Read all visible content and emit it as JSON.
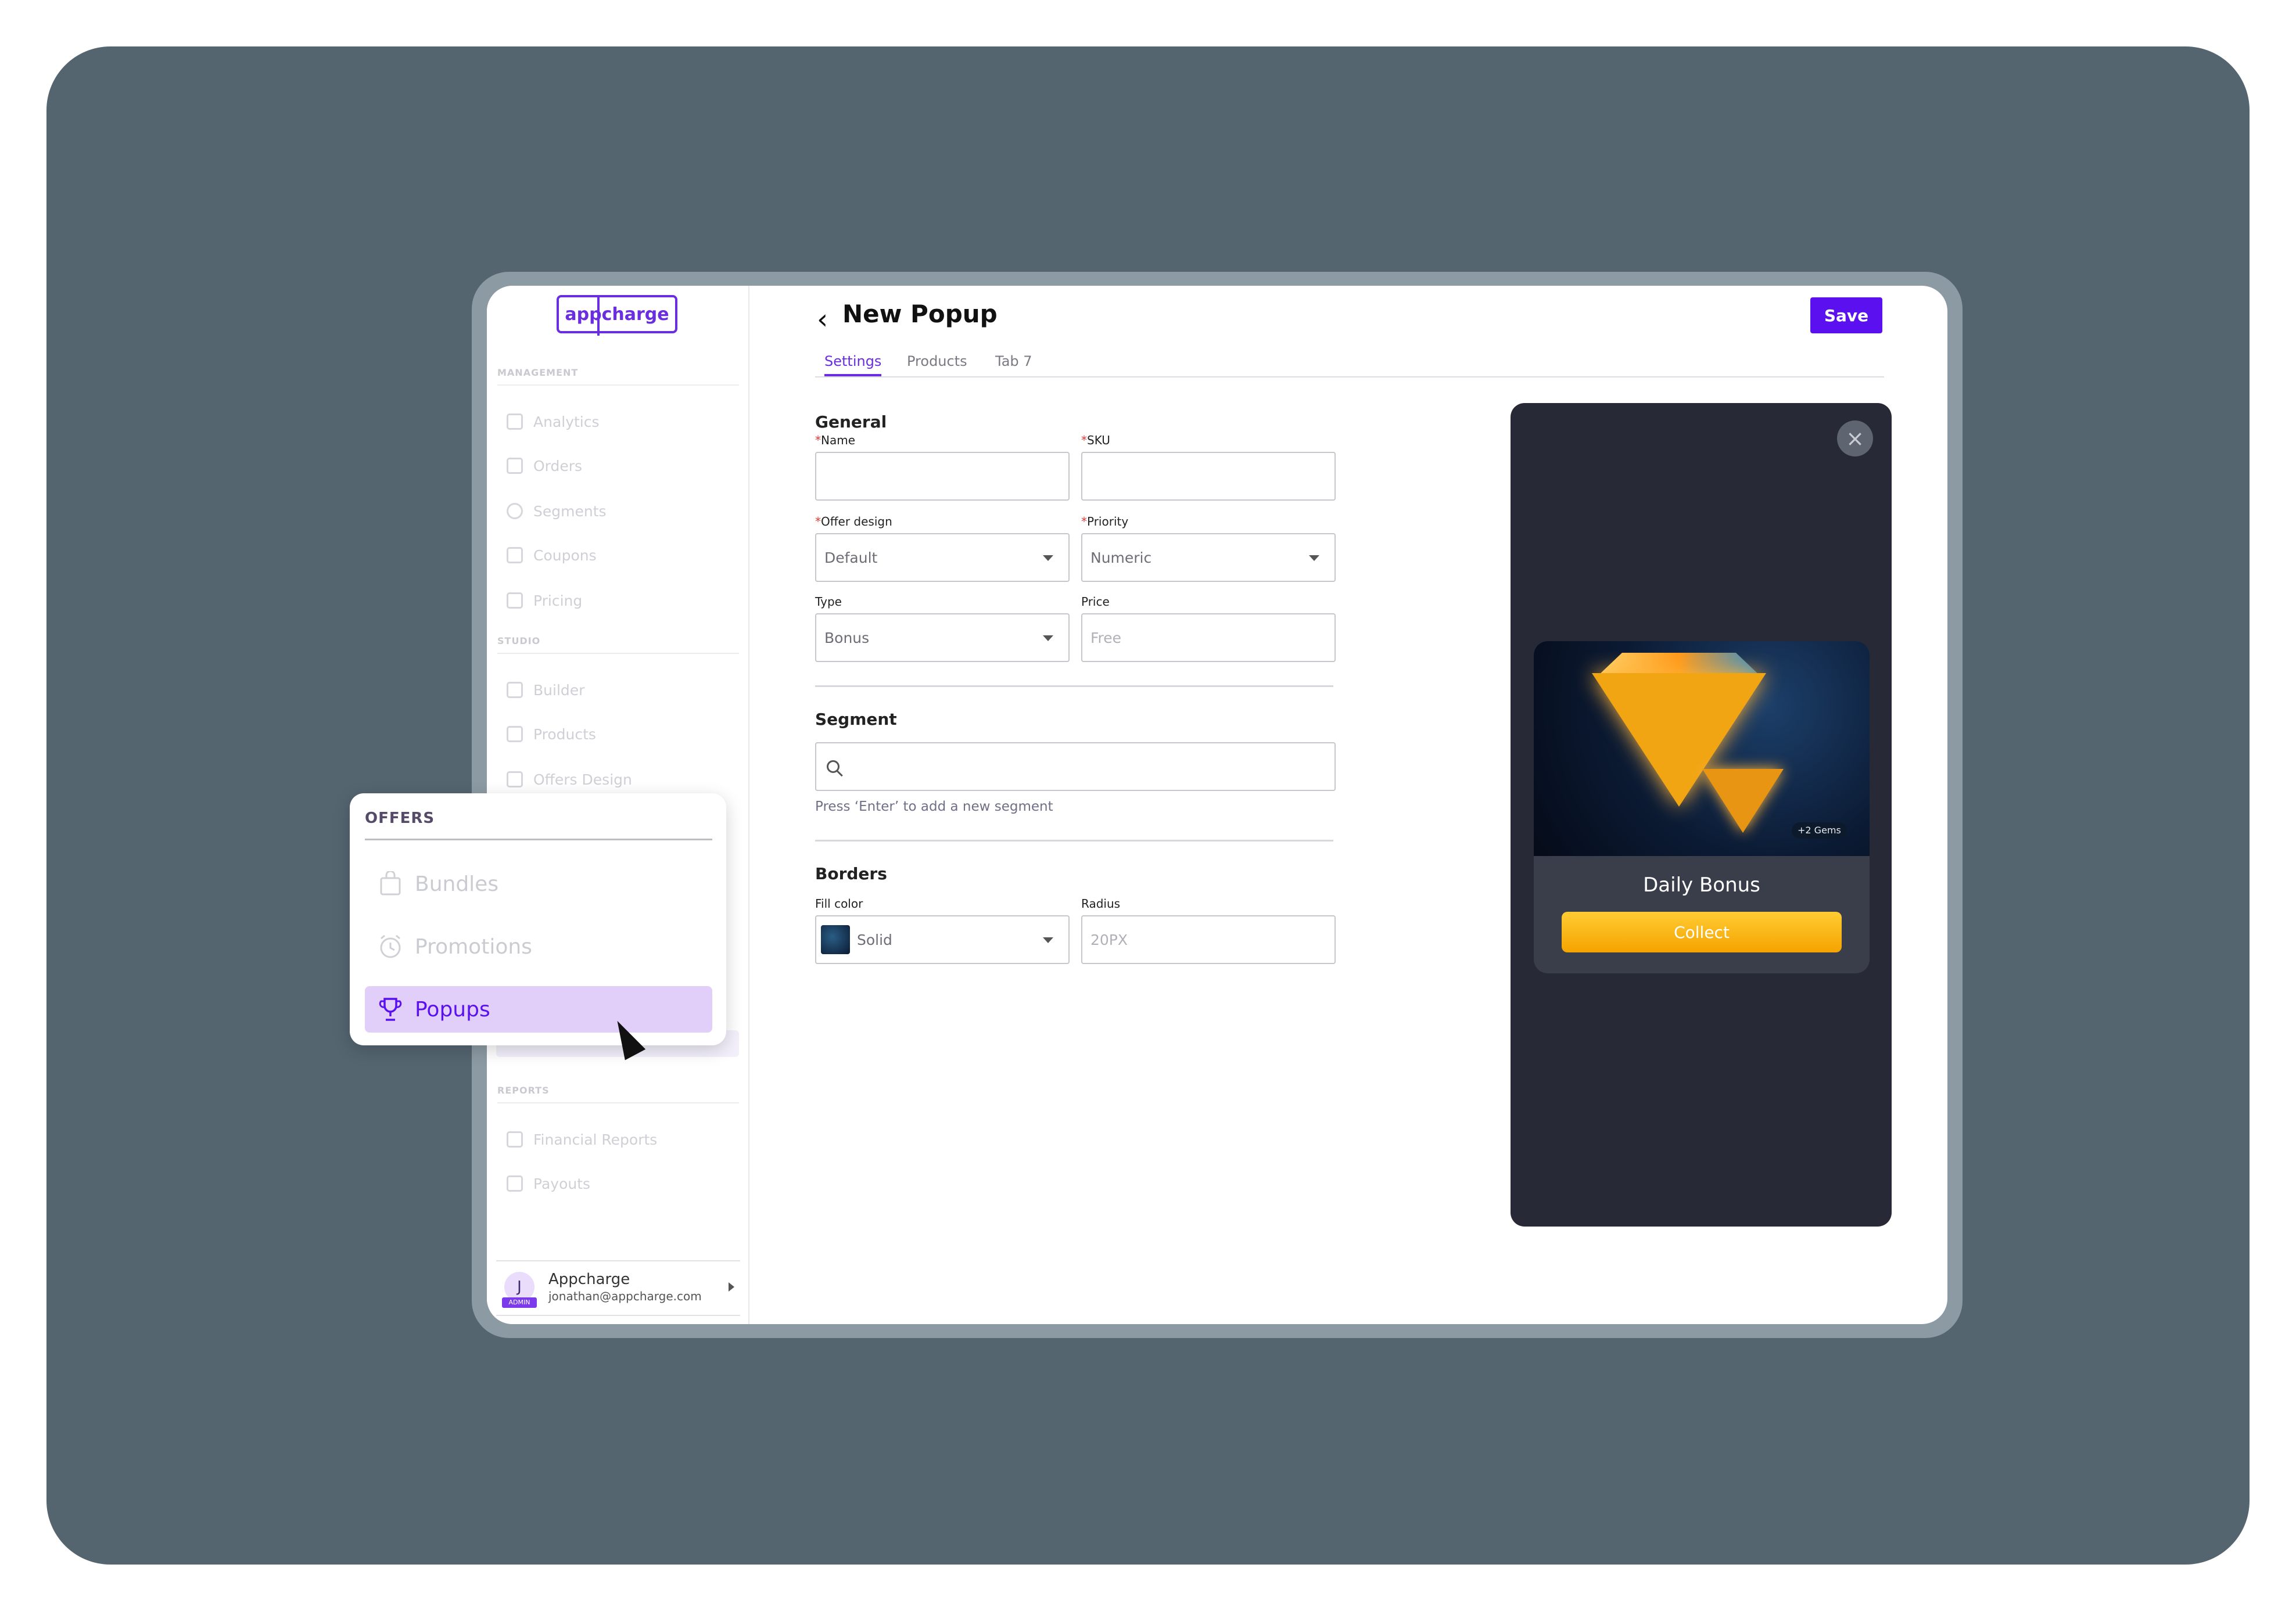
{
  "app": {
    "logo": "appcharge"
  },
  "sidebar": {
    "sections": [
      {
        "label": "MANAGEMENT",
        "items": [
          "Analytics",
          "Orders",
          "Segments",
          "Coupons",
          "Pricing"
        ]
      },
      {
        "label": "STUDIO",
        "items": [
          "Builder",
          "Products",
          "Offers Design"
        ]
      },
      {
        "label": "REPORTS",
        "items": [
          "Financial Reports",
          "Payouts"
        ]
      }
    ],
    "user": {
      "initial": "J",
      "badge": "ADMIN",
      "name": "Appcharge",
      "email": "jonathan@appcharge.com"
    }
  },
  "header": {
    "back_icon": "chevron-left-icon",
    "title": "New Popup",
    "save_label": "Save"
  },
  "tabs": [
    {
      "label": "Settings",
      "active": true
    },
    {
      "label": "Products",
      "active": false
    },
    {
      "label": "Tab 7",
      "active": false
    }
  ],
  "form": {
    "general": {
      "heading": "General",
      "name": {
        "label": "Name",
        "required": "*",
        "value": ""
      },
      "sku": {
        "label": "SKU",
        "required": "*",
        "value": ""
      },
      "offer_design": {
        "label": "Offer design",
        "required": "*",
        "value": "Default"
      },
      "priority": {
        "label": "Priority",
        "required": "*",
        "value": "Numeric"
      },
      "type": {
        "label": "Type",
        "value": "Bonus"
      },
      "price": {
        "label": "Price",
        "placeholder": "Free"
      }
    },
    "segment": {
      "heading": "Segment",
      "value": "",
      "help": "Press ‘Enter’ to add a new segment"
    },
    "borders": {
      "heading": "Borders",
      "fill_color": {
        "label": "Fill color",
        "value": "Solid"
      },
      "radius": {
        "label": "Radius",
        "placeholder": "20PX"
      }
    }
  },
  "preview": {
    "badge": "+2 Gems",
    "title": "Daily Bonus",
    "button": "Collect",
    "colors": {
      "background": "#272a36",
      "card": "#3a3e4b",
      "button": "#f5a300"
    }
  },
  "offers_menu": {
    "title": "OFFERS",
    "items": [
      {
        "label": "Bundles",
        "icon": "bag-icon",
        "active": false
      },
      {
        "label": "Promotions",
        "icon": "clock-icon",
        "active": false
      },
      {
        "label": "Popups",
        "icon": "trophy-icon",
        "active": true
      }
    ]
  },
  "colors": {
    "accent": "#5b10f0",
    "backdrop": "#546570"
  }
}
